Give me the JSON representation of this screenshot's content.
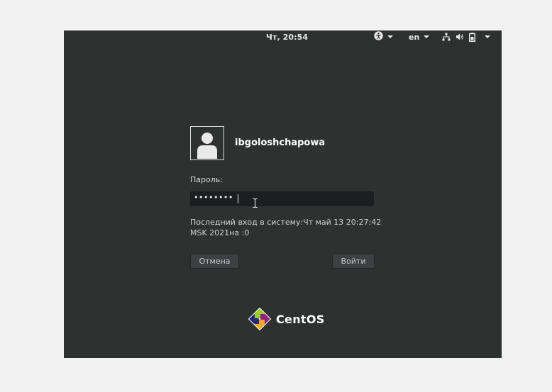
{
  "topbar": {
    "clock": "Чт, 20:54",
    "language": "en",
    "icons": [
      "accessibility-icon",
      "network-icon",
      "volume-icon",
      "battery-icon",
      "power-menu-caret"
    ]
  },
  "login": {
    "username": "ibgoloshchapowa",
    "password_label": "Пароль:",
    "password_masked": "••••••••",
    "last_login_line1": "Последний вход в систему:Чт май 13 20:27:42",
    "last_login_line2": "MSK 2021на :0",
    "cancel_label": "Отмена",
    "login_label": "Войти"
  },
  "brand": {
    "name": "CentOS"
  },
  "colors": {
    "background": "#2f3131",
    "field": "#1d1e1f",
    "text": "#ffffff"
  }
}
